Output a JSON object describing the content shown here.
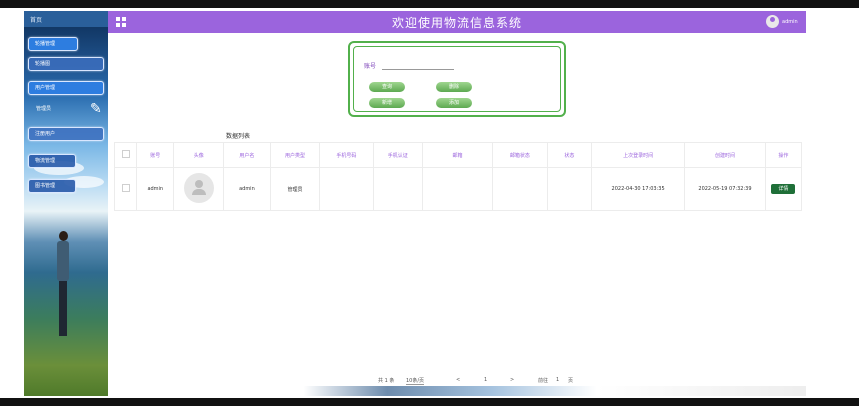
{
  "header": {
    "title": "欢迎使用物流信息系统",
    "user_name": "admin"
  },
  "sidebar": {
    "home_label": "首页",
    "items": [
      {
        "label": "轮播管理"
      },
      {
        "label": "轮播图"
      },
      {
        "label": "用户管理"
      },
      {
        "label": "管理员"
      },
      {
        "label": "注册用户"
      },
      {
        "label": "物流管理"
      },
      {
        "label": "图书管理"
      }
    ]
  },
  "search": {
    "label": "账号",
    "placeholder": "",
    "buttons": [
      "查询",
      "删除",
      "新增",
      "添加"
    ]
  },
  "table": {
    "title": "数据列表",
    "columns": [
      "账号",
      "头像",
      "用户名",
      "用户类型",
      "手机号码",
      "手机认证",
      "邮箱",
      "邮箱状态",
      "状态",
      "上次登录时间",
      "创建时间",
      "操作"
    ],
    "rows": [
      {
        "account": "admin",
        "username": "admin",
        "user_type": "管理员",
        "phone": "",
        "phone_auth": "",
        "email": "",
        "email_status": "",
        "status": "",
        "last_login": "2022-04-30 17:03:35",
        "created": "2022-05-19 07:32:39",
        "action": "详情"
      }
    ]
  },
  "pagination": {
    "total_text": "共 1 条",
    "page_size": "10条/页",
    "prev": "<",
    "current": "1",
    "next": ">",
    "goto_text": "前往",
    "goto_page": "1",
    "page_suffix": "页"
  },
  "colors": {
    "header": "#9b64dd",
    "panel_border": "#52b04b",
    "button_green": "#5da951",
    "detail_button": "#1f6f38"
  }
}
